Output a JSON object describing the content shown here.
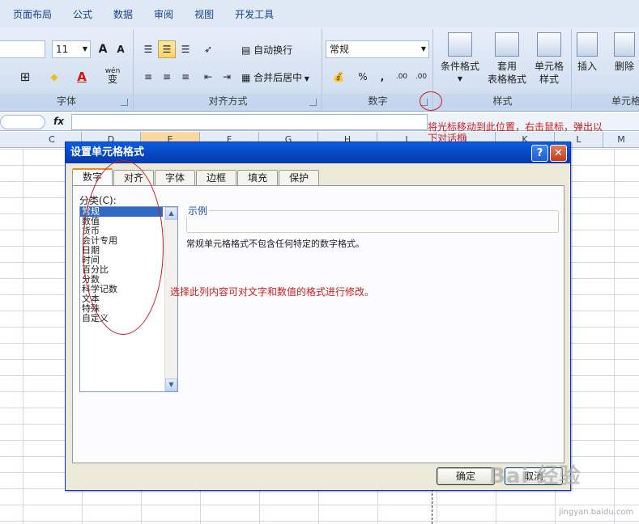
{
  "ribbon": {
    "tabs": [
      "页面布局",
      "公式",
      "数据",
      "审阅",
      "视图",
      "开发工具"
    ],
    "font_group": {
      "label": "字体",
      "size": "11",
      "grow": "A",
      "shrink": "A",
      "border_icon": "⊞",
      "fill_icon": "◆",
      "color_icon": "A",
      "phonetic": "wén",
      "phonetic_char": "变"
    },
    "align_group": {
      "label": "对齐方式",
      "wrap": "自动换行",
      "merge": "合并后居中"
    },
    "number_group": {
      "label": "数字",
      "format": "常规",
      "percent": "%",
      "comma": ",",
      "inc": ".00",
      "dec": ".00"
    },
    "style_group": {
      "label": "样式",
      "cond_line1": "条件格式",
      "table_line1": "套用",
      "table_line2": "表格格式",
      "cell_line1": "单元格",
      "cell_line2": "样式"
    },
    "cells_group": {
      "label": "单元格",
      "insert": "插入",
      "delete": "删除"
    }
  },
  "formula_bar": {
    "fx": "fx"
  },
  "columns": [
    "C",
    "D",
    "E",
    "F",
    "G",
    "H",
    "I",
    "J",
    "K",
    "L",
    "M"
  ],
  "annotations": {
    "top": "将光标移动到此位置，右击鼠标，弹出以",
    "top2": "下对话框",
    "list": "选择此列内容可对文字和数值的格式进行修改。"
  },
  "dialog": {
    "title": "设置单元格格式",
    "help": "?",
    "close": "✕",
    "tabs": [
      "数字",
      "对齐",
      "字体",
      "边框",
      "填充",
      "保护"
    ],
    "category_label": "分类(C):",
    "categories": [
      "常规",
      "数值",
      "货币",
      "会计专用",
      "日期",
      "时间",
      "百分比",
      "分数",
      "科学记数",
      "文本",
      "特殊",
      "自定义"
    ],
    "sample_label": "示例",
    "description": "常规单元格格式不包含任何特定的数字格式。",
    "ok": "确定",
    "cancel": "取消"
  },
  "watermark": {
    "text": "Bai 经验",
    "sub": "jingyan.baidu.com"
  }
}
